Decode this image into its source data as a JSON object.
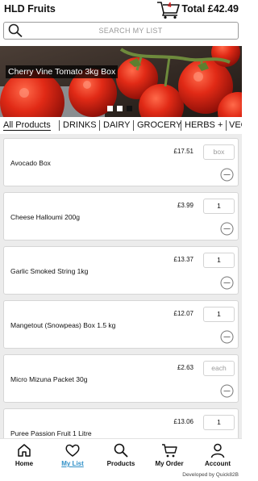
{
  "header": {
    "title": "HLD Fruits",
    "cart_count": "4",
    "total": "Total £42.49"
  },
  "search": {
    "placeholder": "SEARCH MY LIST"
  },
  "banner": {
    "caption": "Cherry Vine Tomato 3kg Box",
    "slide_count": 3,
    "active_slide": 3
  },
  "tabs": [
    "All Products",
    "DRINKS",
    "DAIRY",
    "GROCERY",
    "HERBS +",
    "VEG"
  ],
  "active_tab": "All Products",
  "products": [
    {
      "name": "Avocado Box",
      "price": "£17.51",
      "qty": "box",
      "qty_is_placeholder": true
    },
    {
      "name": "Cheese Halloumi 200g",
      "price": "£3.99",
      "qty": "1",
      "qty_is_placeholder": false
    },
    {
      "name": "Garlic Smoked String 1kg",
      "price": "£13.37",
      "qty": "1",
      "qty_is_placeholder": false
    },
    {
      "name": "Mangetout (Snowpeas) Box 1.5 kg",
      "price": "£12.07",
      "qty": "1",
      "qty_is_placeholder": false
    },
    {
      "name": "Micro Mizuna Packet 30g",
      "price": "£2.63",
      "qty": "each",
      "qty_is_placeholder": true
    },
    {
      "name": "Puree Passion Fruit  1 Litre",
      "price": "£13.06",
      "qty": "1",
      "qty_is_placeholder": false
    }
  ],
  "nav": [
    {
      "label": "Home",
      "icon": "home-icon"
    },
    {
      "label": "My List",
      "icon": "heart-icon"
    },
    {
      "label": "Products",
      "icon": "search-icon"
    },
    {
      "label": "My Order",
      "icon": "cart-icon"
    },
    {
      "label": "Account",
      "icon": "user-icon"
    }
  ],
  "active_nav": "My List",
  "footer": "Developed by Quick82B",
  "colors": {
    "accent": "#2e8fc7",
    "badge": "#dd1111"
  }
}
